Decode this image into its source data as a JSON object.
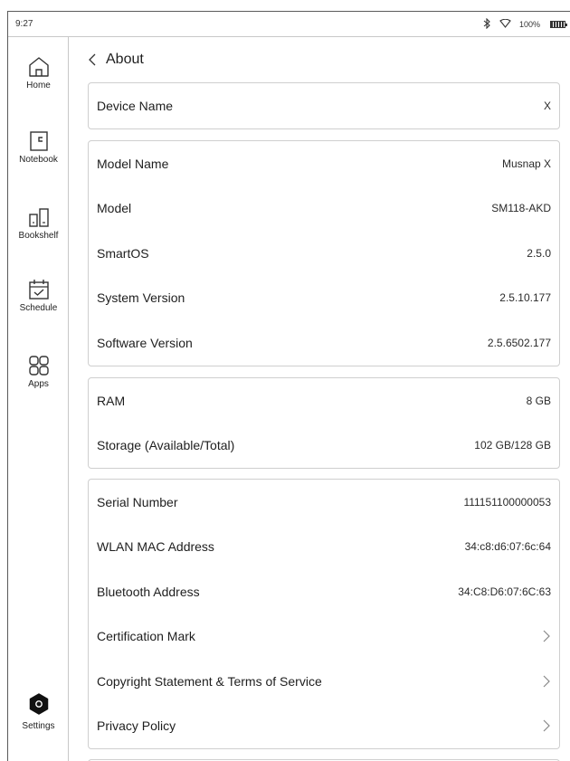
{
  "status_bar": {
    "time": "9:27",
    "battery_text": "100%"
  },
  "sidebar": {
    "items": [
      {
        "label": "Home",
        "icon": "home-icon"
      },
      {
        "label": "Notebook",
        "icon": "notebook-icon"
      },
      {
        "label": "Bookshelf",
        "icon": "bookshelf-icon"
      },
      {
        "label": "Schedule",
        "icon": "calendar-icon"
      },
      {
        "label": "Apps",
        "icon": "apps-icon"
      }
    ],
    "settings": {
      "label": "Settings",
      "icon": "settings-icon"
    }
  },
  "header": {
    "title": "About"
  },
  "device_card": {
    "label": "Device Name",
    "value": "X"
  },
  "model_card": {
    "rows": [
      {
        "label": "Model Name",
        "value": "Musnap X"
      },
      {
        "label": "Model",
        "value": "SM118-AKD"
      },
      {
        "label": "SmartOS",
        "value": "2.5.0"
      },
      {
        "label": "System Version",
        "value": "2.5.10.177"
      },
      {
        "label": "Software Version",
        "value": "2.5.6502.177"
      }
    ]
  },
  "storage_card": {
    "rows": [
      {
        "label": "RAM",
        "value": "8 GB"
      },
      {
        "label": "Storage (Available/Total)",
        "value": "102 GB/128 GB"
      }
    ]
  },
  "info_card": {
    "rows": [
      {
        "label": "Serial Number",
        "value": "111151100000053"
      },
      {
        "label": "WLAN MAC Address",
        "value": "34:c8:d6:07:6c:64"
      },
      {
        "label": "Bluetooth Address",
        "value": "34:C8:D6:07:6C:63"
      }
    ],
    "links": [
      {
        "label": "Certification Mark"
      },
      {
        "label": "Copyright Statement & Terms of Service"
      },
      {
        "label": "Privacy Policy"
      }
    ]
  },
  "colors": {
    "text": "#1e1e1e",
    "border": "#cfcfcf",
    "icon": "#333333"
  }
}
